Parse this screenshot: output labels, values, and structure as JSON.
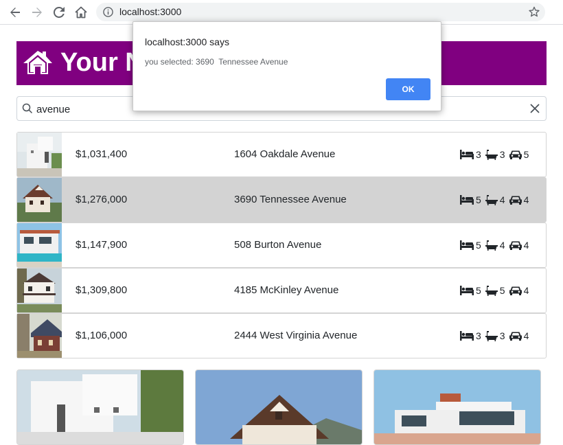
{
  "browser": {
    "url": "localhost:3000"
  },
  "banner": {
    "title": "Your N"
  },
  "search": {
    "value": "avenue"
  },
  "listings": [
    {
      "price": "$1,031,400",
      "address": "1604 Oakdale Avenue",
      "beds": "3",
      "baths": "3",
      "cars": "5",
      "selected": false
    },
    {
      "price": "$1,276,000",
      "address": "3690 Tennessee Avenue",
      "beds": "5",
      "baths": "4",
      "cars": "4",
      "selected": true
    },
    {
      "price": "$1,147,900",
      "address": "508 Burton Avenue",
      "beds": "5",
      "baths": "4",
      "cars": "4",
      "selected": false
    },
    {
      "price": "$1,309,800",
      "address": "4185 McKinley Avenue",
      "beds": "5",
      "baths": "5",
      "cars": "4",
      "selected": false
    },
    {
      "price": "$1,106,000",
      "address": "2444 West Virginia Avenue",
      "beds": "3",
      "baths": "3",
      "cars": "4",
      "selected": false
    }
  ],
  "dialog": {
    "title": "localhost:3000 says",
    "message": "you selected: 3690  Tennessee Avenue",
    "ok_label": "OK"
  },
  "colors": {
    "banner": "#800080",
    "selected_row": "#d3d3d3",
    "ok_button": "#4285f4"
  },
  "icons": {
    "back": "arrow-left-icon",
    "forward": "arrow-right-icon",
    "reload": "reload-icon",
    "home": "home-icon",
    "info": "info-icon",
    "bookmark": "star-icon",
    "search": "search-icon",
    "clear": "close-icon",
    "bed": "bed-icon",
    "bath": "bath-icon",
    "car": "car-icon"
  }
}
